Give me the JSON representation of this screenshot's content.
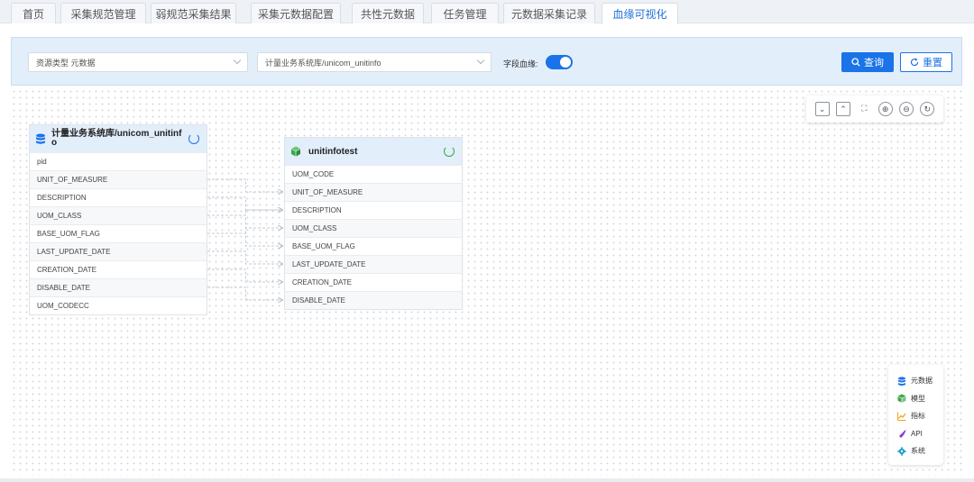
{
  "tabs": [
    {
      "label": "首页",
      "active": false
    },
    {
      "label": "采集规范管理",
      "active": false
    },
    {
      "label": "弱规范采集结果",
      "active": false
    },
    {
      "label": "采集元数据配置",
      "active": false
    },
    {
      "label": "共性元数据",
      "active": false
    },
    {
      "label": "任务管理",
      "active": false
    },
    {
      "label": "元数据采集记录",
      "active": false
    },
    {
      "label": "血缘可视化",
      "active": true
    }
  ],
  "filter": {
    "resource_type": "资源类型 元数据",
    "source": "计量业务系统库/unicom_unitinfo",
    "field_lineage_label": "字段血缘:",
    "field_lineage_on": true,
    "query_label": "查询",
    "reset_label": "重置"
  },
  "zoom_tools": [
    {
      "icon": "collapse-icon",
      "glyph": "⌄"
    },
    {
      "icon": "expand-icon",
      "glyph": "⌃"
    },
    {
      "icon": "fit-screen-icon",
      "glyph": "⛶"
    },
    {
      "icon": "zoom-in-icon",
      "glyph": "⊕"
    },
    {
      "icon": "zoom-out-icon",
      "glyph": "⊖"
    },
    {
      "icon": "reset-view-icon",
      "glyph": "↻"
    }
  ],
  "source_node": {
    "title": "计量业务系统库/unicom_unitinfo",
    "fields": [
      "pid",
      "UNIT_OF_MEASURE",
      "DESCRIPTION",
      "UOM_CLASS",
      "BASE_UOM_FLAG",
      "LAST_UPDATE_DATE",
      "CREATION_DATE",
      "DISABLE_DATE",
      "UOM_CODECC"
    ]
  },
  "target_node": {
    "title": "unitinfotest",
    "fields": [
      "UOM_CODE",
      "UNIT_OF_MEASURE",
      "DESCRIPTION",
      "UOM_CLASS",
      "BASE_UOM_FLAG",
      "LAST_UPDATE_DATE",
      "CREATION_DATE",
      "DISABLE_DATE"
    ]
  },
  "lineage_links": [
    {
      "from": "UNIT_OF_MEASURE",
      "to": "UNIT_OF_MEASURE"
    },
    {
      "from": "DESCRIPTION",
      "to": "DESCRIPTION"
    },
    {
      "from": "UOM_CLASS",
      "to": "UOM_CLASS"
    },
    {
      "from": "BASE_UOM_FLAG",
      "to": "BASE_UOM_FLAG"
    },
    {
      "from": "LAST_UPDATE_DATE",
      "to": "LAST_UPDATE_DATE"
    },
    {
      "from": "CREATION_DATE",
      "to": "CREATION_DATE"
    },
    {
      "from": "DISABLE_DATE",
      "to": "DISABLE_DATE"
    },
    {
      "from": "UOM_CLASS",
      "to": "DESCRIPTION"
    },
    {
      "from": "UOM_CLASS",
      "to": "BASE_UOM_FLAG"
    }
  ],
  "legend": [
    {
      "label": "元数据",
      "icon": "database-icon",
      "color": "#1a73e8"
    },
    {
      "label": "模型",
      "icon": "cube-icon",
      "color": "#3aa84a"
    },
    {
      "label": "指标",
      "icon": "line-chart-icon",
      "color": "#f0a020"
    },
    {
      "label": "API",
      "icon": "plug-icon",
      "color": "#8a3ad9"
    },
    {
      "label": "系统",
      "icon": "gear-icon",
      "color": "#1aa0c8"
    }
  ],
  "colors": {
    "accent": "#1a73e8",
    "panel": "#e3eefb"
  }
}
